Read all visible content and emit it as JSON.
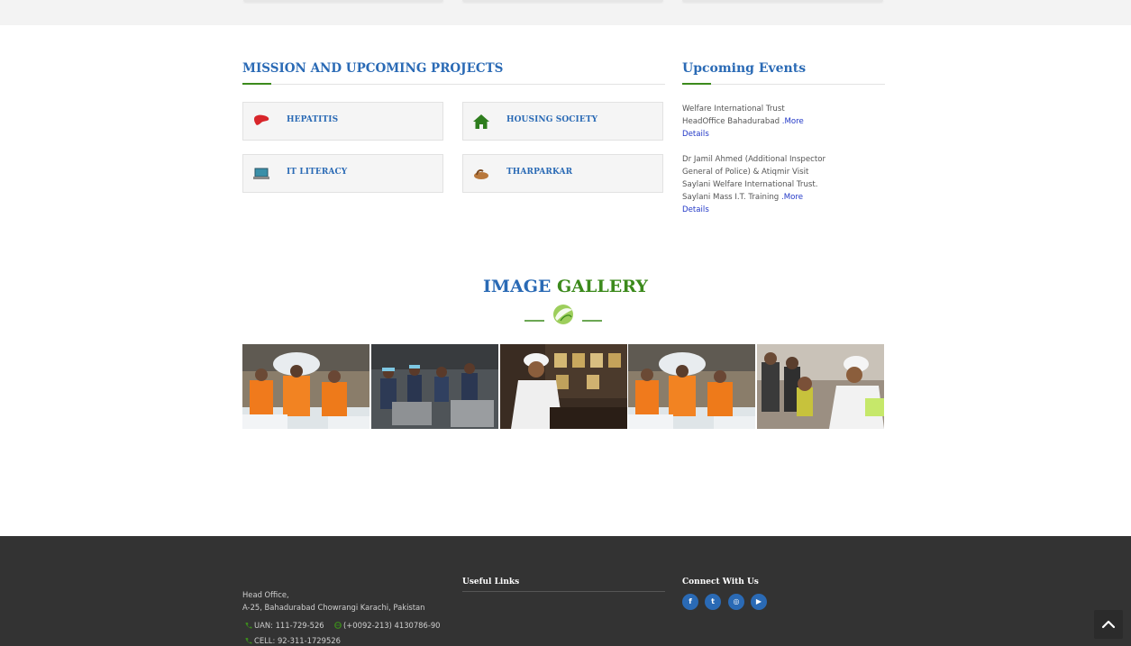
{
  "colors": {
    "blue": "#2a6ab5",
    "green": "#3c8a1c",
    "footer": "#333333",
    "link": "#2238c7"
  },
  "mission": {
    "title": "MISSION AND UPCOMING PROJECTS",
    "projects": [
      {
        "label": "HEPATITIS",
        "icon": "liver-icon"
      },
      {
        "label": "HOUSING SOCIETY",
        "icon": "home-icon"
      },
      {
        "label": "IT LITERACY",
        "icon": "laptop-icon"
      },
      {
        "label": "THARPARKAR",
        "icon": "tharparkar-icon"
      }
    ]
  },
  "events": {
    "title": "Upcoming Events",
    "items": [
      {
        "lines": [
          "Welfare International Trust",
          "HeadOffice Bahadurabad"
        ],
        "more": ".More",
        "details": "Details"
      },
      {
        "lines": [
          "Dr Jamil Ahmed (Additional Inspector",
          "General of Police) & Atiqmir Visit",
          "Saylani Welfare International Trust.",
          "Saylani Mass I.T. Training"
        ],
        "more": ".More",
        "details": "Details"
      }
    ]
  },
  "gallery": {
    "title_part1": "IMAGE",
    "title_part2": "GALLERY",
    "images": [
      "volunteers-carrying-sacks",
      "kitchen-cooking-pots",
      "scholar-at-desk",
      "volunteers-carrying-sacks",
      "children-with-elder"
    ]
  },
  "footer": {
    "address_line1": "Head Office,",
    "address_line2": "A-25, Bahadurabad Chowrangi Karachi, Pakistan",
    "uan": "UAN: 111-729-526",
    "phone": "(+0092-213) 4130786-90",
    "cell": "CELL: 92-311-1729526",
    "useful_links_title": "Useful Links",
    "connect_title": "Connect With Us",
    "social": [
      {
        "name": "facebook-icon",
        "glyph": "f"
      },
      {
        "name": "twitter-icon",
        "glyph": "t"
      },
      {
        "name": "instagram-icon",
        "glyph": "◎"
      },
      {
        "name": "youtube-icon",
        "glyph": "▶"
      }
    ]
  }
}
